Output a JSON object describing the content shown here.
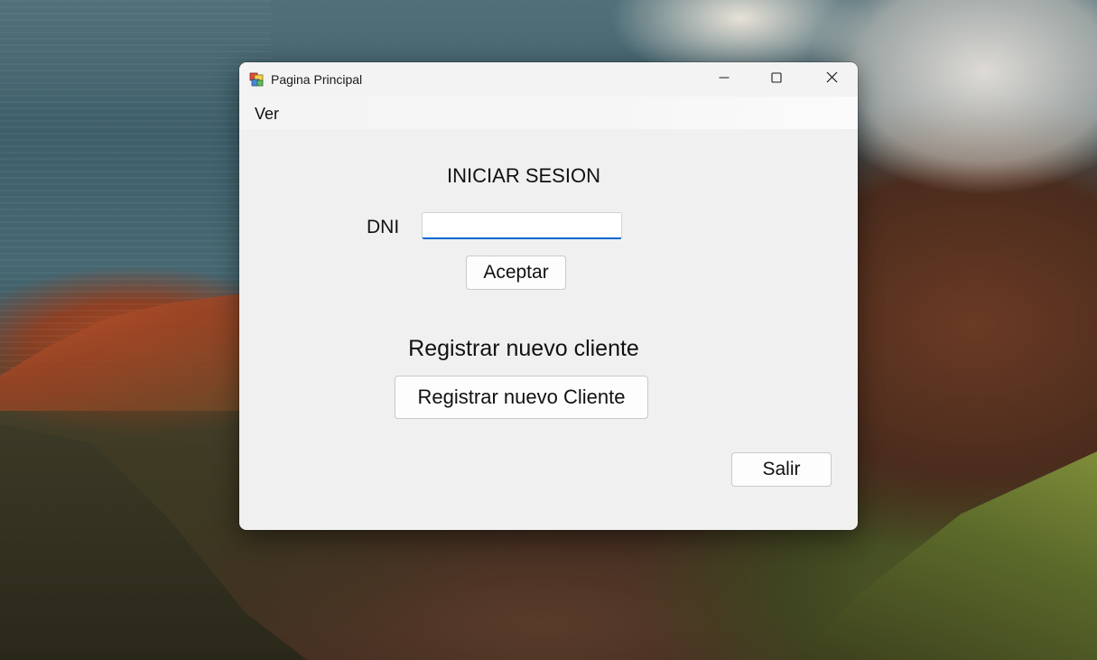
{
  "window": {
    "title": "Pagina Principal",
    "app_icon": "winforms-app-icon",
    "controls": {
      "minimize_icon": "minimize-icon",
      "maximize_icon": "maximize-icon",
      "close_icon": "close-icon"
    }
  },
  "menubar": {
    "items": [
      {
        "label": "Ver"
      }
    ]
  },
  "login": {
    "heading": "INICIAR SESION",
    "dni_label": "DNI",
    "dni_value": "",
    "dni_placeholder": "",
    "accept_button": "Aceptar"
  },
  "register": {
    "label": "Registrar nuevo cliente",
    "button": "Registrar nuevo Cliente"
  },
  "footer": {
    "exit_button": "Salir"
  },
  "colors": {
    "window_background": "#f0f0f0",
    "input_focus_underline": "#0066cc",
    "text": "#111111"
  }
}
